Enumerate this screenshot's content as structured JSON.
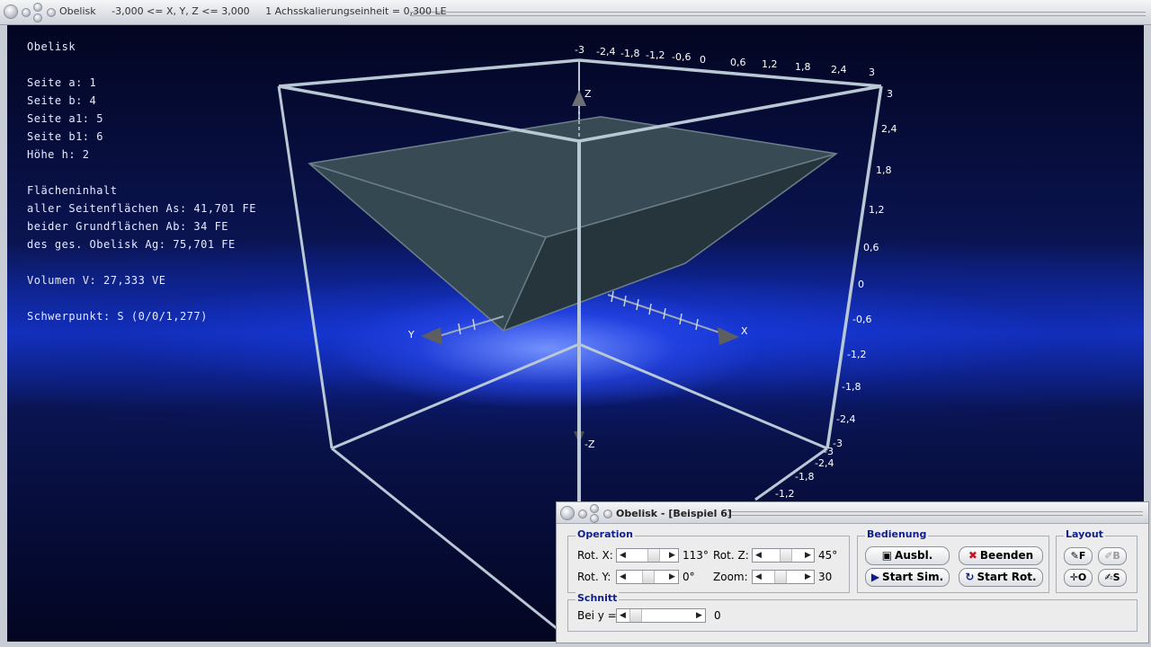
{
  "window": {
    "title": "Obelisk     -3,000 <= X, Y, Z <= 3,000     1 Achsskalierungseinheit = 0,300 LE"
  },
  "info": {
    "heading": "Obelisk",
    "seite_a": "Seite a: 1",
    "seite_b": "Seite b: 4",
    "seite_a1": "Seite a1: 5",
    "seite_b1": "Seite b1: 6",
    "hoehe": "Höhe h: 2",
    "flaeche_heading": "Flächeninhalt",
    "as": "aller Seitenflächen As: 41,701 FE",
    "ab": "beider Grundflächen Ab: 34 FE",
    "ag": "des ges. Obelisk Ag: 75,701 FE",
    "volumen": "Volumen V: 27,333 VE",
    "schwerpunkt": "Schwerpunkt: S (0/0/1,277)"
  },
  "axes": {
    "x_label": "X",
    "y_label": "Y",
    "z_label": "Z",
    "neg_z_label": "-Z",
    "top_ticks": [
      "-3",
      "-2,4",
      "-1,8",
      "-1,2",
      "-0,6",
      "0",
      "0,6",
      "1,2",
      "1,8",
      "2,4",
      "3"
    ],
    "right_ticks": [
      "3",
      "2,4",
      "1,8",
      "1,2",
      "0,6",
      "0",
      "-0,6",
      "-1,2",
      "-1,8",
      "-2,4",
      "-3"
    ],
    "bottom_ticks": [
      "-3",
      "-2,4",
      "-1,8",
      "-1,2"
    ]
  },
  "colors": {
    "background_dark": "#030521",
    "background_glow": "#1535c8",
    "cube_edge": "#b8c8d4",
    "obelisk_fill": "#2b3a42",
    "legend_text": "#10208c"
  },
  "dialog": {
    "title": "Obelisk - [Beispiel 6]",
    "operation": {
      "legend": "Operation",
      "rot_x_label": "Rot. X:",
      "rot_x_value": "113°",
      "rot_y_label": "Rot. Y:",
      "rot_y_value": "0°",
      "rot_z_label": "Rot. Z:",
      "rot_z_value": "45°",
      "zoom_label": "Zoom:",
      "zoom_value": "30"
    },
    "bedienung": {
      "legend": "Bedienung",
      "ausbl": "Ausbl.",
      "beenden": "Beenden",
      "start_sim": "Start Sim.",
      "start_rot": "Start Rot."
    },
    "layout": {
      "legend": "Layout",
      "f": "F",
      "b": "B",
      "o": "O",
      "s": "S"
    },
    "schnitt": {
      "legend": "Schnitt",
      "bei_y_label": "Bei y =",
      "bei_y_value": "0"
    }
  }
}
